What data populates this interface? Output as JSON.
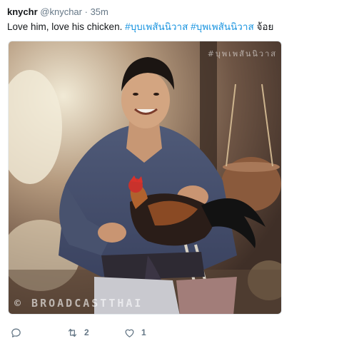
{
  "tweet": {
    "display_name": "knychr",
    "handle": "@knychar",
    "separator": "·",
    "time": "35m",
    "text_plain": "Love him, love his chicken. ",
    "hashtag1": "#บุบเพสันนิวาส",
    "hashtag2": "#บุพเพสันนิวาส",
    "text_trailing": " จ้อย",
    "media": {
      "watermark_top": "#บุพเพสันนิวาส",
      "watermark_bottom": "© BROADCASTTHAI"
    },
    "actions": {
      "reply_icon": "speech-bubble-icon",
      "retweet_icon": "retweet-arrows-icon",
      "retweet_count": "2",
      "like_icon": "heart-icon",
      "like_count": "1"
    },
    "colors": {
      "link": "#1b95e0",
      "muted": "#657786",
      "text": "#14171a"
    }
  }
}
